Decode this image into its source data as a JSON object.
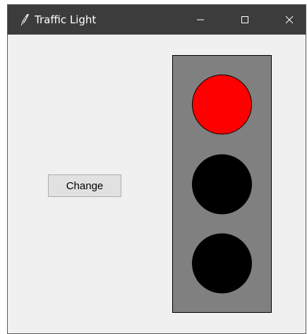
{
  "window": {
    "title": "Traffic Light",
    "controls": {
      "minimize_icon": "minimize-icon",
      "maximize_icon": "maximize-icon",
      "close_icon": "close-icon"
    }
  },
  "main": {
    "change_button_label": "Change",
    "traffic_light": {
      "housing_color": "#808080",
      "lights": [
        {
          "position": "top",
          "state": "on",
          "color": "#ff0000"
        },
        {
          "position": "middle",
          "state": "off",
          "color": "#000000"
        },
        {
          "position": "bottom",
          "state": "off",
          "color": "#000000"
        }
      ]
    }
  }
}
